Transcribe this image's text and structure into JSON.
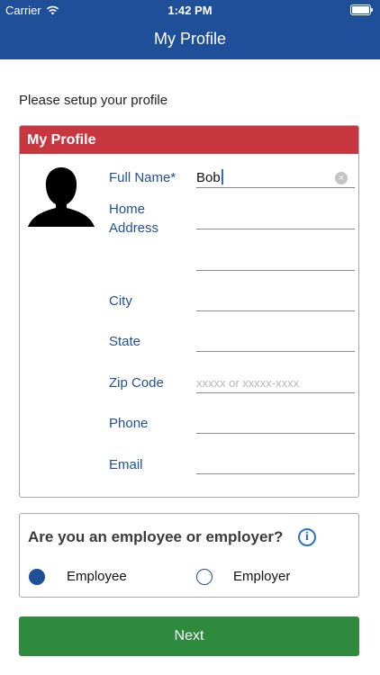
{
  "status_bar": {
    "carrier": "Carrier",
    "time": "1:42 PM"
  },
  "nav": {
    "title": "My Profile"
  },
  "intro_text": "Please setup your profile",
  "profile_card": {
    "header": "My Profile",
    "fields": {
      "full_name": {
        "label": "Full Name*",
        "value": "Bob"
      },
      "home_address": {
        "label_line1": "Home",
        "label_line2": "Address",
        "value": ""
      },
      "city": {
        "label": "City",
        "value": ""
      },
      "state": {
        "label": "State",
        "value": ""
      },
      "zip": {
        "label": "Zip Code",
        "placeholder": "xxxxx or xxxxx-xxxx",
        "value": ""
      },
      "phone": {
        "label": "Phone",
        "value": ""
      },
      "email": {
        "label": "Email",
        "value": ""
      }
    }
  },
  "role_card": {
    "question": "Are you an employee or employer?",
    "options": [
      {
        "label": "Employee",
        "selected": true
      },
      {
        "label": "Employer",
        "selected": false
      }
    ]
  },
  "next_button": {
    "label": "Next"
  },
  "colors": {
    "nav_blue": "#1f4f99",
    "header_red": "#c8373f",
    "label_blue": "#1f4f99",
    "next_green": "#2e8b3d"
  },
  "icons": {
    "signal": "wifi-icon",
    "avatar": "person-silhouette-icon",
    "clear": "clear-icon",
    "info": "info-icon"
  }
}
